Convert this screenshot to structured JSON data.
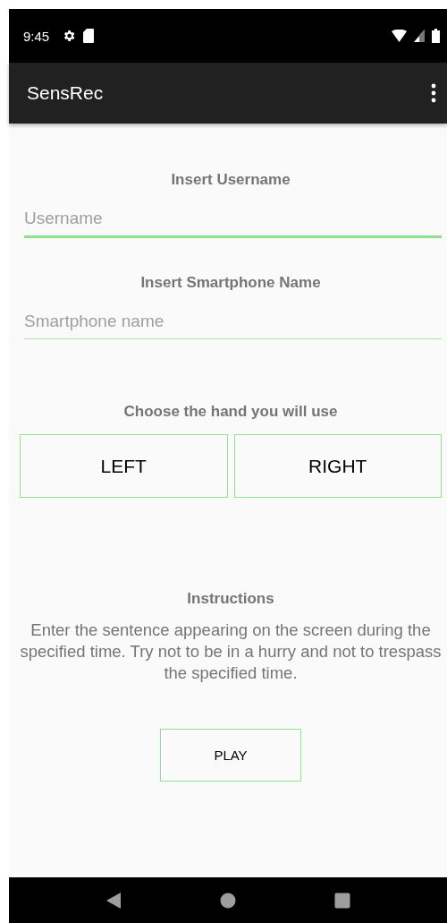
{
  "status_bar": {
    "time": "9:45"
  },
  "app_bar": {
    "title": "SensRec"
  },
  "fields": [
    {
      "label": "Insert Username",
      "placeholder": "Username",
      "focused": true
    },
    {
      "label": "Insert Smartphone Name",
      "placeholder": "Smartphone name",
      "focused": false
    }
  ],
  "hand": {
    "label": "Choose the hand you will use",
    "buttons": [
      {
        "label": "LEFT",
        "selected": false
      },
      {
        "label": "RIGHT",
        "selected": false
      }
    ]
  },
  "instructions": {
    "title": "Instructions",
    "text": "Enter the sentence appearing on the screen during the specified time. Try not to be in a hurry and not to trespass the specified time."
  },
  "play_button": "PLAY"
}
